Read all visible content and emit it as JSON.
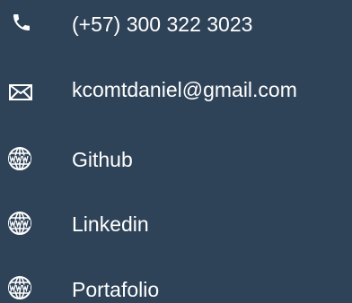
{
  "contact": {
    "items": [
      {
        "kind": "phone",
        "icon": "phone-icon",
        "label": "(+57) 300 322 3023"
      },
      {
        "kind": "email",
        "icon": "envelope-icon",
        "label": "kcomtdaniel@gmail.com"
      },
      {
        "kind": "link",
        "icon": "globe-www-icon",
        "label": "Github"
      },
      {
        "kind": "link",
        "icon": "globe-www-icon",
        "label": "Linkedin"
      },
      {
        "kind": "link",
        "icon": "globe-www-icon",
        "label": "Portafolio"
      }
    ]
  },
  "colors": {
    "background": "#2f4358",
    "text": "#ffffff"
  }
}
